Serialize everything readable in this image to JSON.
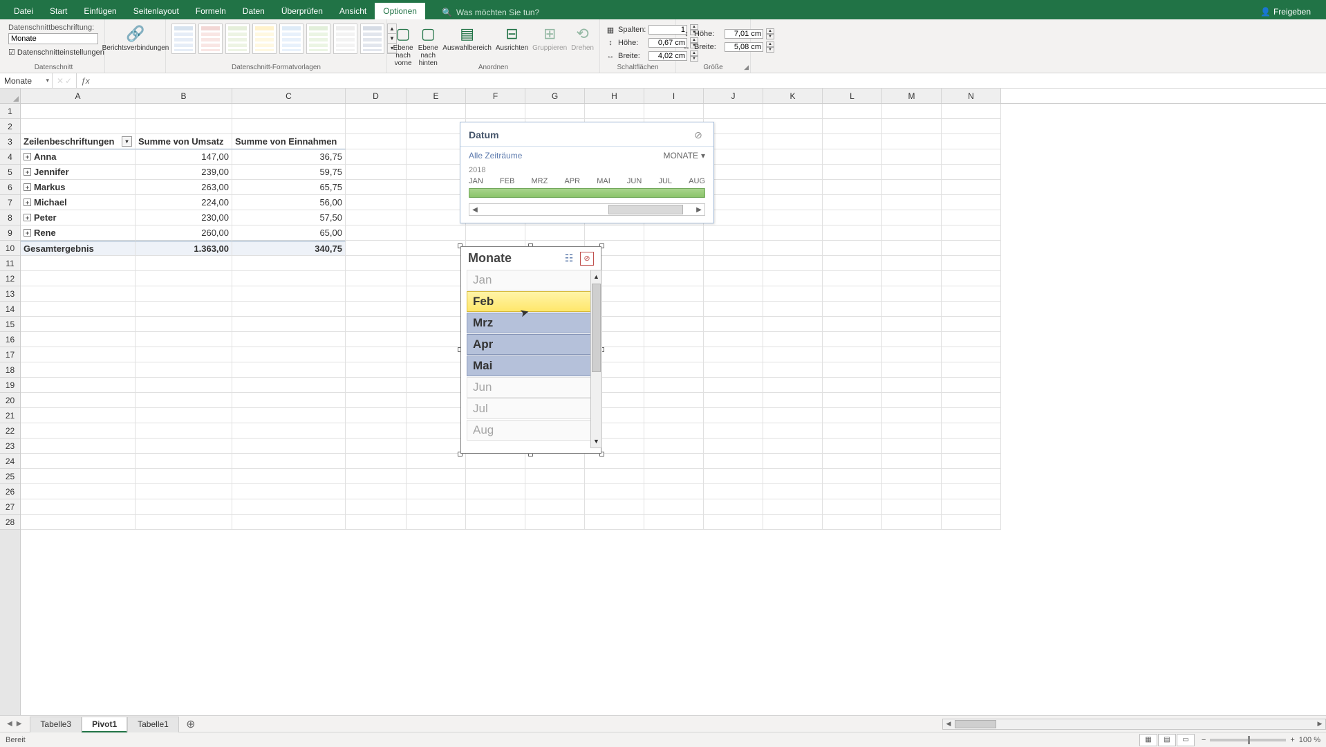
{
  "app": {
    "tabs": [
      "Datei",
      "Start",
      "Einfügen",
      "Seitenlayout",
      "Formeln",
      "Daten",
      "Überprüfen",
      "Ansicht",
      "Optionen"
    ],
    "active_tab": 8,
    "search_placeholder": "Was möchten Sie tun?",
    "share": "Freigeben"
  },
  "ribbon": {
    "caption_label": "Datenschnittbeschriftung:",
    "caption_value": "Monate",
    "slicer_settings": "Datenschnitteinstellungen",
    "report_connections": "Berichtsverbindungen",
    "group_slicer": "Datenschnitt",
    "group_styles": "Datenschnitt-Formatvorlagen",
    "group_arrange": "Anordnen",
    "group_buttons": "Schaltflächen",
    "group_size": "Größe",
    "arrange": {
      "front": "Ebene nach vorne",
      "back": "Ebene nach hinten",
      "selpane": "Auswahlbereich",
      "align": "Ausrichten",
      "group": "Gruppieren",
      "rotate": "Drehen"
    },
    "buttons": {
      "cols_label": "Spalten:",
      "cols": "1",
      "h_label": "Höhe:",
      "h": "0,67 cm",
      "w_label": "Breite:",
      "w": "4,02 cm"
    },
    "size": {
      "h_label": "Höhe:",
      "h": "7,01 cm",
      "w_label": "Breite:",
      "w": "5,08 cm"
    }
  },
  "namebox": "Monate",
  "columns": [
    "A",
    "B",
    "C",
    "D",
    "E",
    "F",
    "G",
    "H",
    "I",
    "J",
    "K",
    "L",
    "M",
    "N"
  ],
  "rows_count": 28,
  "pivot": {
    "hdr": {
      "a": "Zeilenbeschriftungen",
      "b": "Summe von Umsatz",
      "c": "Summe von Einnahmen"
    },
    "rows": [
      {
        "name": "Anna",
        "b": "147,00",
        "c": "36,75"
      },
      {
        "name": "Jennifer",
        "b": "239,00",
        "c": "59,75"
      },
      {
        "name": "Markus",
        "b": "263,00",
        "c": "65,75"
      },
      {
        "name": "Michael",
        "b": "224,00",
        "c": "56,00"
      },
      {
        "name": "Peter",
        "b": "230,00",
        "c": "57,50"
      },
      {
        "name": "Rene",
        "b": "260,00",
        "c": "65,00"
      }
    ],
    "total": {
      "a": "Gesamtergebnis",
      "b": "1.363,00",
      "c": "340,75"
    }
  },
  "timeline": {
    "title": "Datum",
    "range": "Alle Zeiträume",
    "level": "MONATE",
    "year": "2018",
    "months": [
      "JAN",
      "FEB",
      "MRZ",
      "APR",
      "MAI",
      "JUN",
      "JUL",
      "AUG"
    ]
  },
  "slicer": {
    "title": "Monate",
    "items": [
      {
        "label": "Jan",
        "state": "unsel"
      },
      {
        "label": "Feb",
        "state": "hover"
      },
      {
        "label": "Mrz",
        "state": "selected"
      },
      {
        "label": "Apr",
        "state": "selected"
      },
      {
        "label": "Mai",
        "state": "selected"
      },
      {
        "label": "Jun",
        "state": "unsel"
      },
      {
        "label": "Jul",
        "state": "unsel"
      },
      {
        "label": "Aug",
        "state": "unsel"
      }
    ]
  },
  "sheets": {
    "tabs": [
      "Tabelle3",
      "Pivot1",
      "Tabelle1"
    ],
    "active": 1
  },
  "status": {
    "ready": "Bereit",
    "zoom": "100 %"
  }
}
